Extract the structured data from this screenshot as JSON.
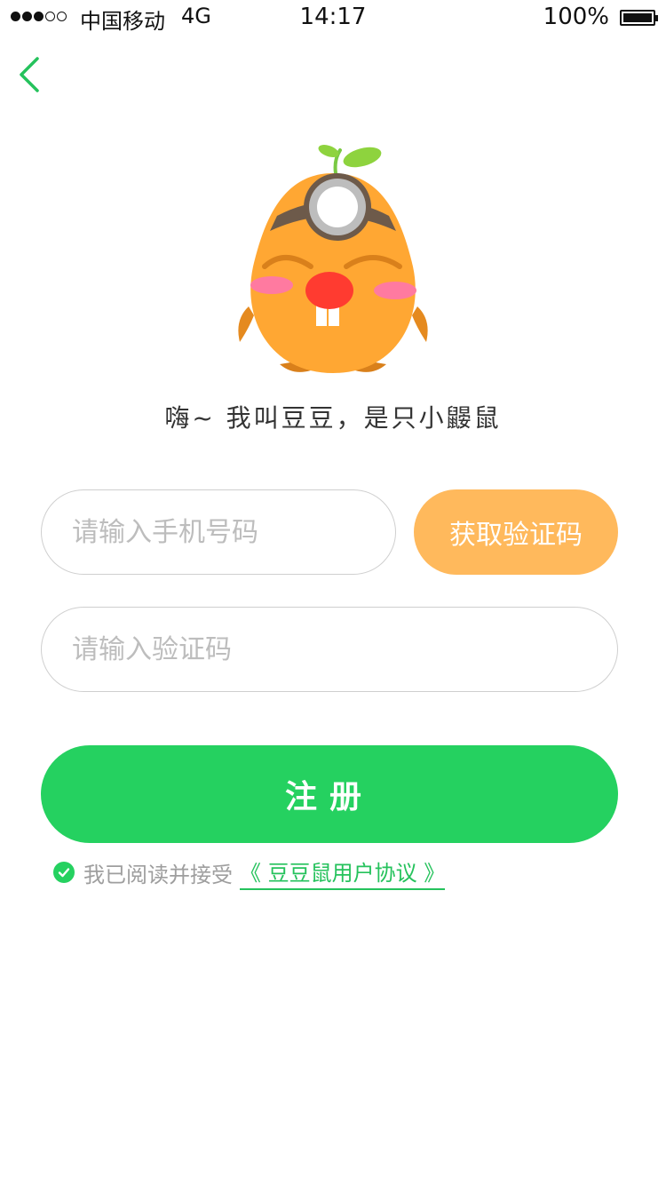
{
  "status_bar": {
    "signal_dots": [
      true,
      true,
      true,
      false,
      false
    ],
    "carrier": "中国移动",
    "network": "4G",
    "time": "14:17",
    "battery_percent": "100%"
  },
  "header": {
    "back_icon": "chevron-left-icon"
  },
  "mascot": {
    "greeting": "嗨~ 我叫豆豆，是只小鼹鼠"
  },
  "form": {
    "phone_placeholder": "请输入手机号码",
    "phone_value": "",
    "get_code_label": "获取验证码",
    "code_placeholder": "请输入验证码",
    "code_value": "",
    "register_label": "注册"
  },
  "agreement": {
    "checked": true,
    "prefix": "我已阅读并接受",
    "link_text": "《 豆豆鼠用户协议 》"
  },
  "colors": {
    "accent_green": "#25d160",
    "button_orange": "#ffb95c",
    "mascot_orange": "#ffa733",
    "mascot_nose": "#ff3b30"
  }
}
